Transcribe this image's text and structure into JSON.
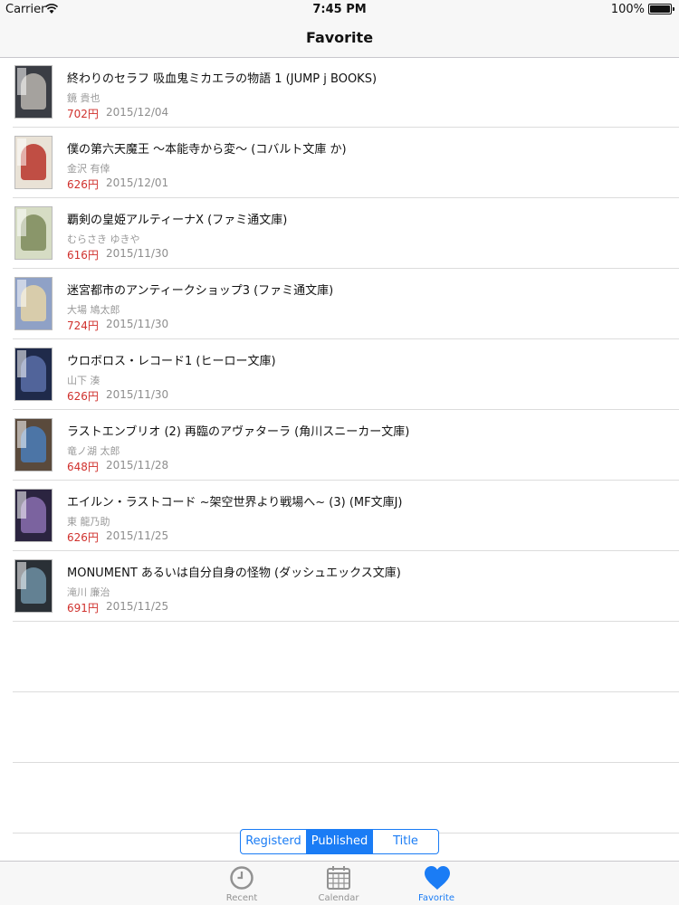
{
  "status": {
    "carrier": "Carrier",
    "time": "7:45 PM",
    "battery": "100%"
  },
  "nav": {
    "title": "Favorite"
  },
  "books": [
    {
      "title": "終わりのセラフ 吸血鬼ミカエラの物語 1 (JUMP j BOOKS)",
      "author": "鏡 貴也",
      "price": "702円",
      "date": "2015/12/04"
    },
    {
      "title": "僕の第六天魔王 〜本能寺から変〜 (コバルト文庫 か)",
      "author": "金沢 有倖",
      "price": "626円",
      "date": "2015/12/01"
    },
    {
      "title": "覇剣の皇姫アルティーナX (ファミ通文庫)",
      "author": "むらさき ゆきや",
      "price": "616円",
      "date": "2015/11/30"
    },
    {
      "title": "迷宮都市のアンティークショップ3 (ファミ通文庫)",
      "author": "大場 鳩太郎",
      "price": "724円",
      "date": "2015/11/30"
    },
    {
      "title": "ウロボロス・レコード1 (ヒーロー文庫)",
      "author": "山下 湊",
      "price": "626円",
      "date": "2015/11/30"
    },
    {
      "title": "ラストエンブリオ (2) 再臨のアヴァターラ (角川スニーカー文庫)",
      "author": "竜ノ湖 太郎",
      "price": "648円",
      "date": "2015/11/28"
    },
    {
      "title": "エイルン・ラストコード ~架空世界より戦場へ~ (3) (MF文庫J)",
      "author": "東 龍乃助",
      "price": "626円",
      "date": "2015/11/25"
    },
    {
      "title": "MONUMENT あるいは自分自身の怪物 (ダッシュエックス文庫)",
      "author": "滝川 廉治",
      "price": "691円",
      "date": "2015/11/25"
    }
  ],
  "segments": {
    "registered": "Registerd",
    "published": "Published",
    "title": "Title",
    "selected": "Published"
  },
  "tabs": {
    "recent": "Recent",
    "calendar": "Calendar",
    "favorite": "Favorite",
    "selected": "Favorite"
  },
  "colors": {
    "accent": "#1a7cf5",
    "price": "#d0312d"
  }
}
